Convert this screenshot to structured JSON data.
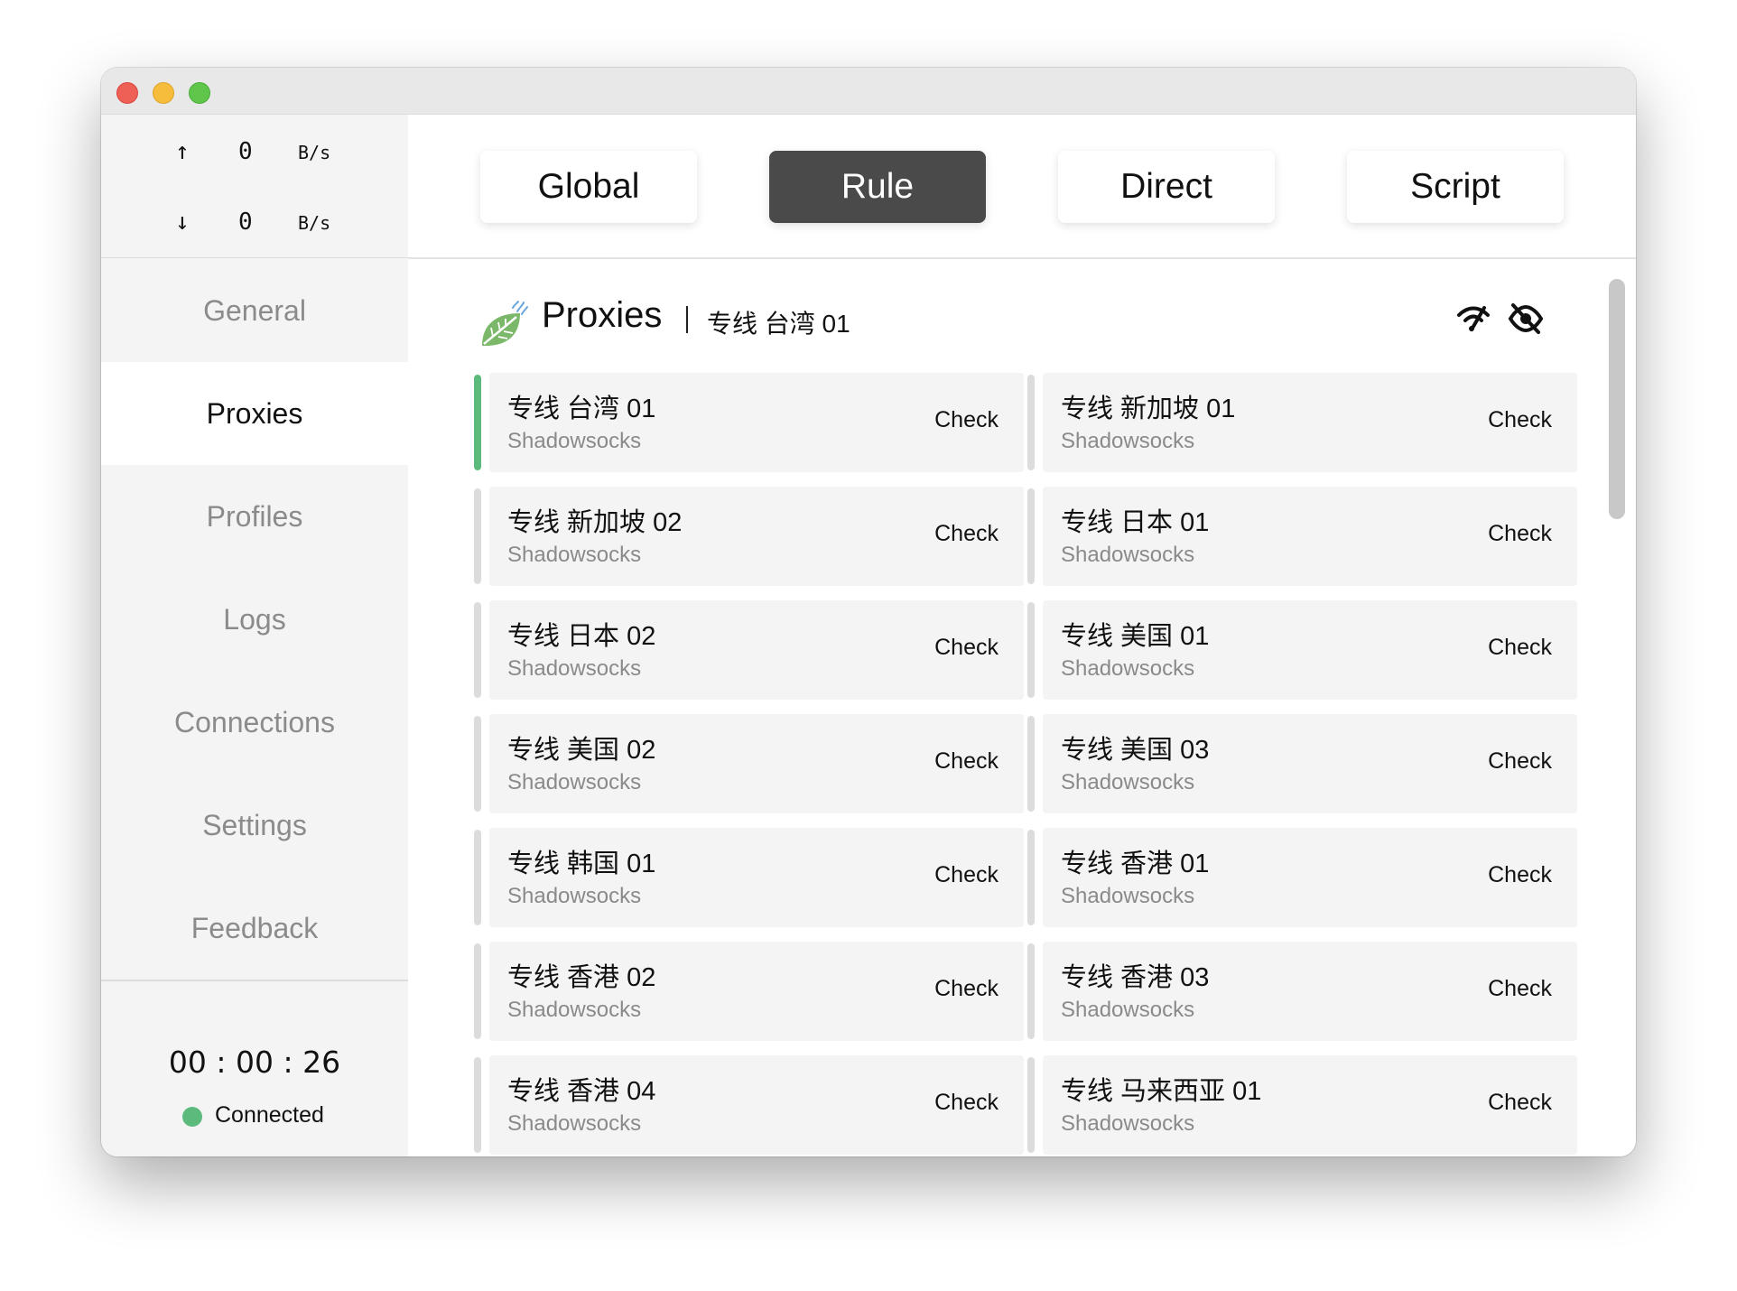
{
  "window": {
    "traffic_lights": [
      "close",
      "minimize",
      "zoom"
    ]
  },
  "stats": {
    "upload_arrow": "↑",
    "upload_value": "0",
    "upload_unit": "B/s",
    "download_arrow": "↓",
    "download_value": "0",
    "download_unit": "B/s"
  },
  "sidebar": {
    "items": [
      {
        "label": "General"
      },
      {
        "label": "Proxies"
      },
      {
        "label": "Profiles"
      },
      {
        "label": "Logs"
      },
      {
        "label": "Connections"
      },
      {
        "label": "Settings"
      },
      {
        "label": "Feedback"
      }
    ],
    "active_index": 1,
    "timer": "00 : 00 : 26",
    "status": "Connected",
    "status_color": "#5dba7d"
  },
  "modes": {
    "items": [
      {
        "label": "Global"
      },
      {
        "label": "Rule"
      },
      {
        "label": "Direct"
      },
      {
        "label": "Script"
      }
    ],
    "active_index": 1
  },
  "proxies": {
    "title": "Proxies",
    "selected_label": "专线 台湾 01",
    "icons": [
      "leaf-icon",
      "wifi-speed-icon",
      "eye-slash-icon"
    ],
    "check_label": "Check",
    "cards": [
      {
        "name": "专线 台湾 01",
        "type": "Shadowsocks",
        "selected": true
      },
      {
        "name": "专线 新加坡 01",
        "type": "Shadowsocks",
        "selected": false
      },
      {
        "name": "专线 新加坡 02",
        "type": "Shadowsocks",
        "selected": false
      },
      {
        "name": "专线 日本 01",
        "type": "Shadowsocks",
        "selected": false
      },
      {
        "name": "专线 日本 02",
        "type": "Shadowsocks",
        "selected": false
      },
      {
        "name": "专线 美国 01",
        "type": "Shadowsocks",
        "selected": false
      },
      {
        "name": "专线 美国 02",
        "type": "Shadowsocks",
        "selected": false
      },
      {
        "name": "专线 美国 03",
        "type": "Shadowsocks",
        "selected": false
      },
      {
        "name": "专线 韩国 01",
        "type": "Shadowsocks",
        "selected": false
      },
      {
        "name": "专线 香港 01",
        "type": "Shadowsocks",
        "selected": false
      },
      {
        "name": "专线 香港 02",
        "type": "Shadowsocks",
        "selected": false
      },
      {
        "name": "专线 香港 03",
        "type": "Shadowsocks",
        "selected": false
      },
      {
        "name": "专线 香港 04",
        "type": "Shadowsocks",
        "selected": false
      },
      {
        "name": "专线 马来西亚 01",
        "type": "Shadowsocks",
        "selected": false
      }
    ]
  }
}
